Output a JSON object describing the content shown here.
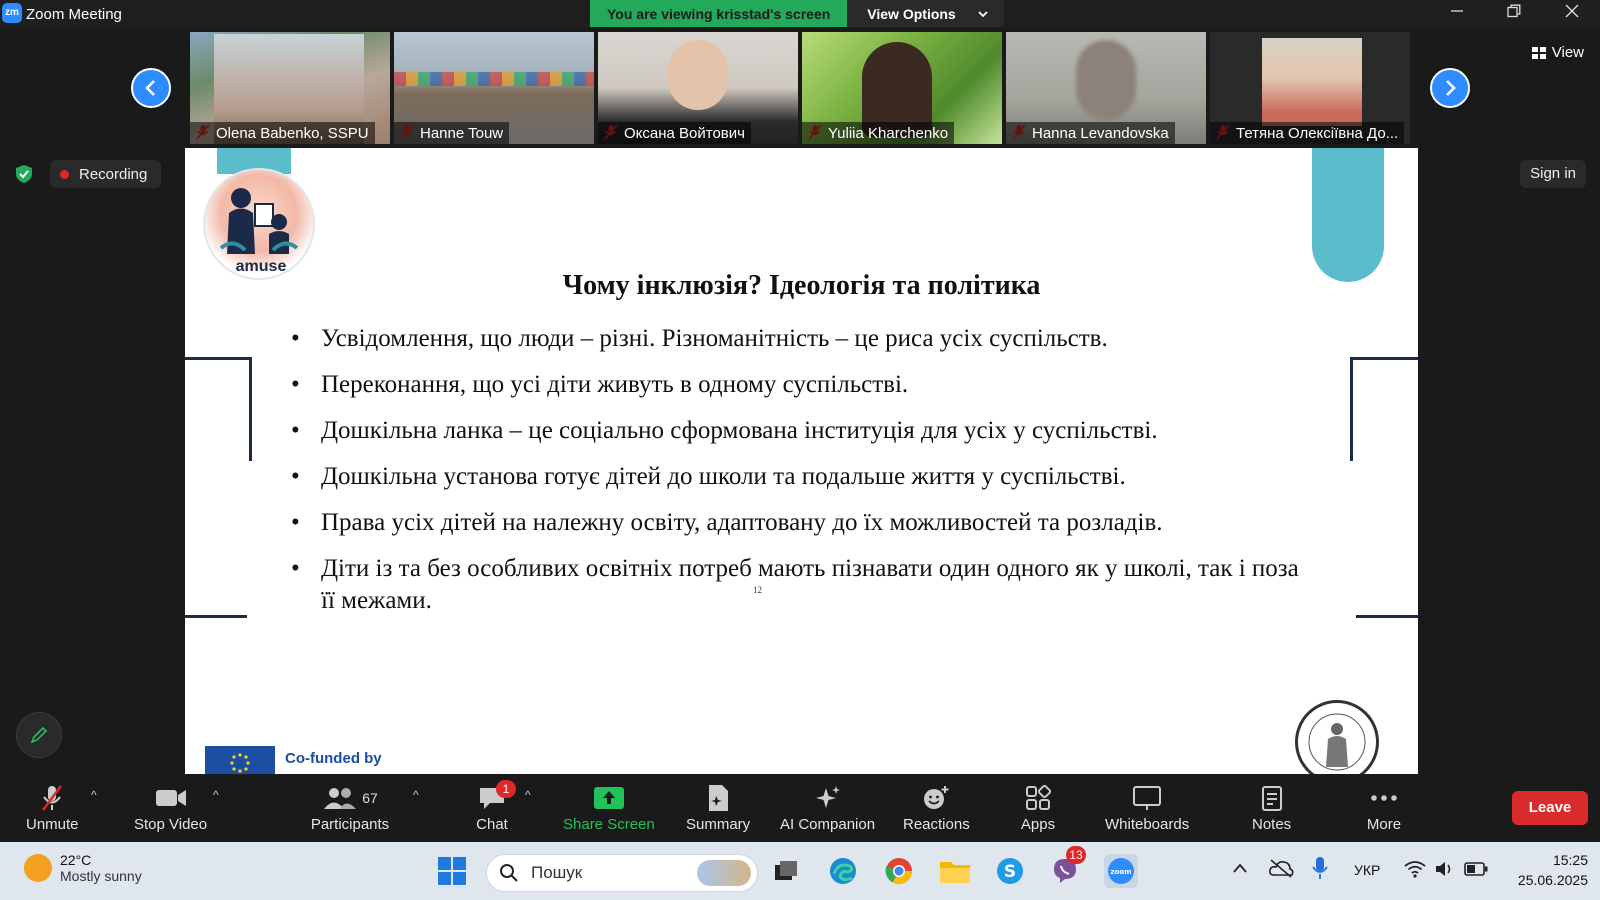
{
  "window": {
    "app_icon_text": "zm",
    "title": "Zoom Meeting",
    "share_banner": "You are viewing krisstad's screen",
    "view_options": "View Options"
  },
  "gallery": {
    "view_label": "View",
    "participants": [
      {
        "name": "Olena Babenko, SSPU"
      },
      {
        "name": "Hanne Touw"
      },
      {
        "name": "Оксана Войтович"
      },
      {
        "name": "Yuliia Kharchenko"
      },
      {
        "name": "Hanna Levandovska"
      },
      {
        "name": "Тетяна Олексіївна До..."
      }
    ]
  },
  "status": {
    "recording": "Recording",
    "sign_in": "Sign in"
  },
  "slide": {
    "logo_text": "amuse",
    "title": "Чому інклюзія?  Ідеологія та політика",
    "bullets": [
      "Усвідомлення, що люди – різні. Різноманітність – це риса усіх суспільств.",
      "Переконання, що усі діти живуть в одному суспільстві.",
      "Дошкільна ланка – це соціально сформована інституція для усіх у суспільстві.",
      "Дошкільна установа готує дітей до школи та подальше життя у суспільстві.",
      "Права усіх дітей на належну освіту, адаптовану до їх можливостей та розладів.",
      "Діти із та без особливих освітніх потреб мають пізнавати один одного як у школі, так і поза її межами."
    ],
    "page_number": "12",
    "cofunded": "Co-funded by"
  },
  "toolbar": {
    "unmute": "Unmute",
    "stop_video": "Stop Video",
    "participants": "Participants",
    "participants_count": "67",
    "chat": "Chat",
    "chat_badge": "1",
    "share_screen": "Share Screen",
    "summary": "Summary",
    "ai_companion": "AI Companion",
    "reactions": "Reactions",
    "apps": "Apps",
    "whiteboards": "Whiteboards",
    "notes": "Notes",
    "more": "More",
    "leave": "Leave"
  },
  "taskbar": {
    "temperature": "22°C",
    "weather": "Mostly sunny",
    "search_placeholder": "Пошук",
    "viber_badge": "13",
    "language": "УКР",
    "time": "15:25",
    "date": "25.06.2025"
  },
  "colors": {
    "zoom_blue": "#2d8cff",
    "share_green": "#23a95a",
    "leave_red": "#d92b2b",
    "slide_teal": "#5bbccc",
    "slide_navy": "#1c2a4a"
  }
}
